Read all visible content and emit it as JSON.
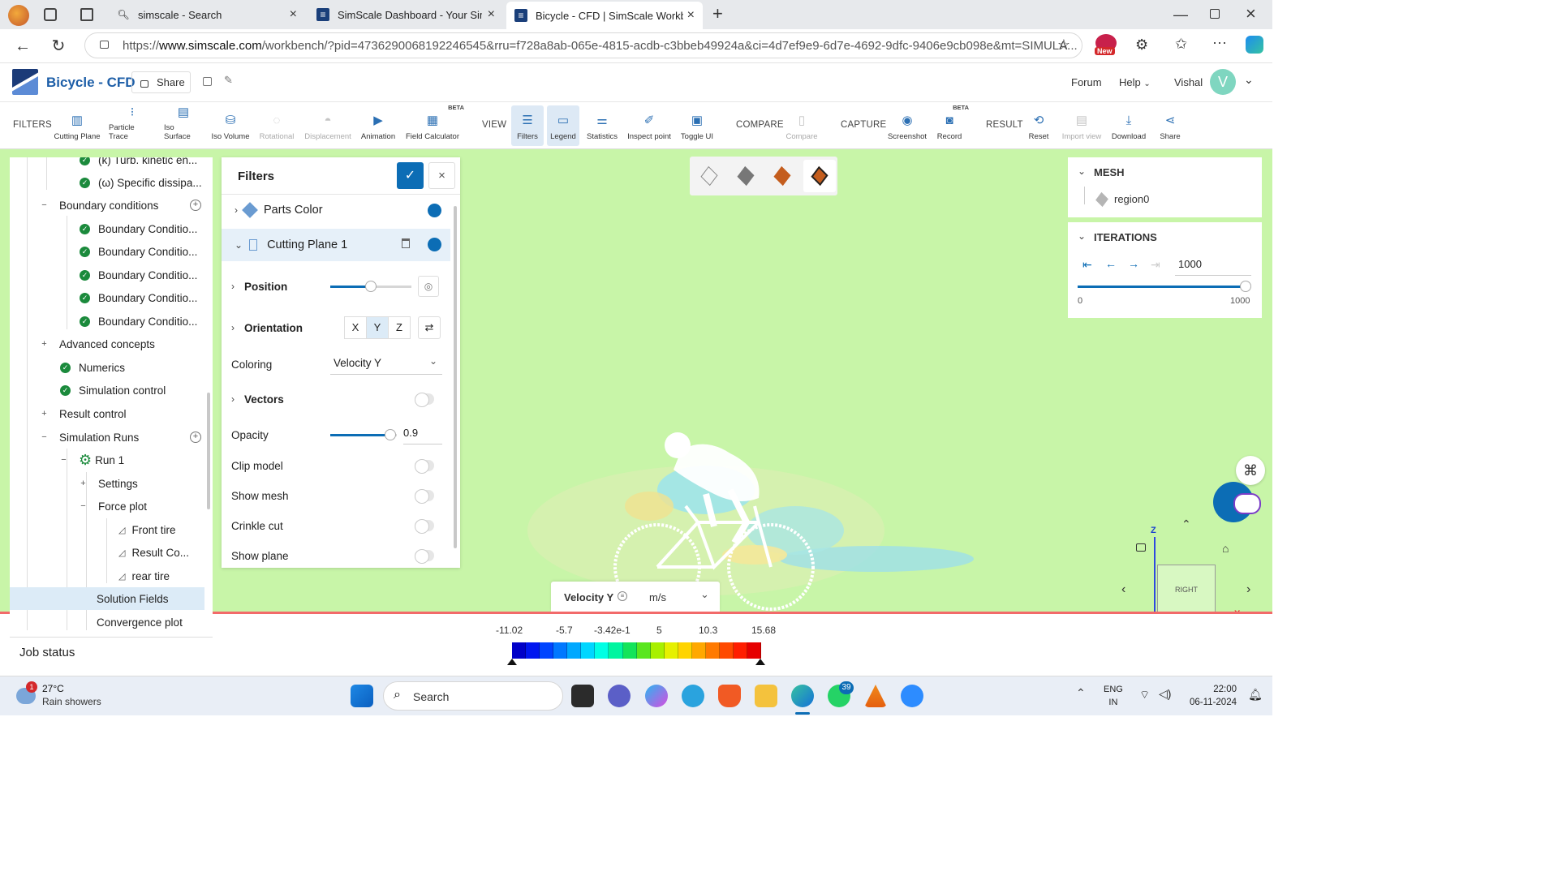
{
  "browser": {
    "tabs": [
      {
        "title": "simscale - Search",
        "icon": "search-icon"
      },
      {
        "title": "SimScale Dashboard - Your Simula",
        "icon": "simscale-logo-icon"
      },
      {
        "title": "Bicycle - CFD | SimScale Workben",
        "icon": "simscale-logo-icon"
      }
    ],
    "url_prefix": "https://",
    "url_domain": "www.simscale.com",
    "url_rest": "/workbench/?pid=4736290068192246545&rru=f728a8ab-065e-4815-acdb-c3bbeb49924a&ci=4d7ef9e9-6d7e-4692-9dfc-9406e9cb098e&mt=SIMULA...",
    "new_badge": "New"
  },
  "app": {
    "project_title": "Bicycle - CFD",
    "share_label": "Share",
    "nav": {
      "forum": "Forum",
      "help": "Help",
      "user": "Vishal",
      "avatar_letter": "V"
    }
  },
  "toolbar": {
    "filters_group": "FILTERS",
    "view_group": "VIEW",
    "compare_group": "COMPARE",
    "capture_group": "CAPTURE",
    "result_group": "RESULT",
    "beta": "BETA",
    "buttons": {
      "cutting_plane": "Cutting Plane",
      "particle_trace": "Particle Trace",
      "iso_surface": "Iso Surface",
      "iso_volume": "Iso Volume",
      "rotational": "Rotational",
      "displacement": "Displacement",
      "animation": "Animation",
      "field_calculator": "Field Calculator",
      "filters": "Filters",
      "legend": "Legend",
      "statistics": "Statistics",
      "inspect_point": "Inspect point",
      "toggle_ui": "Toggle UI",
      "compare": "Compare",
      "screenshot": "Screenshot",
      "record": "Record",
      "reset": "Reset",
      "import_view": "Import view",
      "download": "Download",
      "share": "Share"
    }
  },
  "tree": {
    "items": [
      "(k) Turb. kinetic en...",
      "(ω) Specific dissipa...",
      "Boundary conditions",
      "Boundary Conditio...",
      "Boundary Conditio...",
      "Boundary Conditio...",
      "Boundary Conditio...",
      "Boundary Conditio...",
      "Advanced concepts",
      "Numerics",
      "Simulation control",
      "Result control",
      "Simulation Runs",
      "Run 1",
      "Settings",
      "Force plot",
      "Front tire",
      "Result Co...",
      "rear tire",
      "Solution Fields",
      "Convergence plot"
    ],
    "job_status": "Job status"
  },
  "filters_panel": {
    "title": "Filters",
    "parts_color": "Parts Color",
    "cutting_plane": "Cutting Plane 1",
    "position": "Position",
    "position_level": 0.5,
    "orientation": "Orientation",
    "axes": [
      "X",
      "Y",
      "Z"
    ],
    "active_axis": "Y",
    "coloring": "Coloring",
    "coloring_value": "Velocity Y",
    "vectors": "Vectors",
    "opacity": "Opacity",
    "opacity_value": "0.9",
    "clip_model": "Clip model",
    "show_mesh": "Show mesh",
    "crinkle_cut": "Crinkle cut",
    "show_plane": "Show plane"
  },
  "mesh_panel": {
    "title": "MESH",
    "item": "region0"
  },
  "iterations_panel": {
    "title": "ITERATIONS",
    "value": "1000",
    "min": "0",
    "max": "1000",
    "level": 1.0
  },
  "legend": {
    "field": "Velocity Y",
    "unit": "m/s",
    "ticks": [
      "-11.02",
      "-5.7",
      "-3.42e-1",
      "5",
      "10.3",
      "15.68"
    ],
    "colors": [
      "#0000c8",
      "#0016f0",
      "#0045ff",
      "#0078ff",
      "#00a8ff",
      "#00d6ff",
      "#00ffe4",
      "#00f5a0",
      "#14e45a",
      "#5ae61e",
      "#a8f000",
      "#e6f000",
      "#ffd400",
      "#ffa800",
      "#ff7a00",
      "#ff4a00",
      "#ff1e00",
      "#e60000"
    ]
  },
  "orientation_gizmo": {
    "face_label": "RIGHT",
    "z": "Z",
    "x": "X"
  },
  "taskbar": {
    "weather_temp": "27°C",
    "weather_desc": "Rain showers",
    "weather_badge": "1",
    "search": "Search",
    "whatsapp_badge": "39",
    "lang": "ENG",
    "region": "IN",
    "time": "22:00",
    "date": "06-11-2024"
  }
}
